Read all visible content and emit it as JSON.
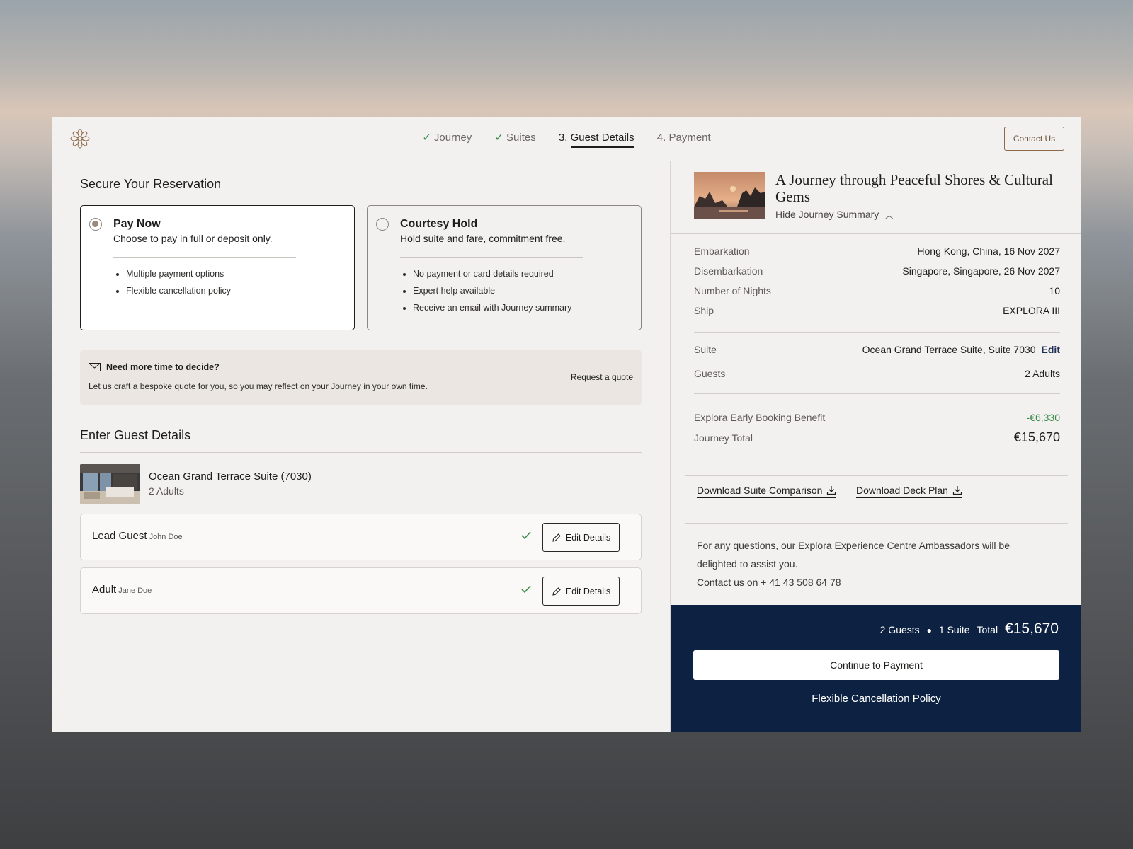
{
  "header": {
    "steps": [
      {
        "label": "Journey",
        "prefix": "",
        "done": true
      },
      {
        "label": "Suites",
        "prefix": "",
        "done": true
      },
      {
        "label": "Guest Details",
        "prefix": "3.",
        "done": false,
        "active": true
      },
      {
        "label": "Payment",
        "prefix": "4.",
        "done": false
      }
    ],
    "contact_label": "Contact Us"
  },
  "reservation": {
    "title": "Secure Your Reservation",
    "options": [
      {
        "title": "Pay Now",
        "subtitle": "Choose to pay in full or deposit only.",
        "bullets": [
          "Multiple payment options",
          "Flexible cancellation policy"
        ],
        "selected": true
      },
      {
        "title": "Courtesy Hold",
        "subtitle": "Hold suite and fare, commitment free.",
        "bullets": [
          "No payment or card details required",
          "Expert help available",
          "Receive an email with Journey summary"
        ],
        "selected": false
      }
    ]
  },
  "quote": {
    "title": "Need more time to decide?",
    "text": "Let us craft a bespoke quote for you, so you may reflect on your Journey in your own time.",
    "link": "Request a quote"
  },
  "guests": {
    "title": "Enter Guest Details",
    "suite_name": "Ocean Grand Terrace Suite (7030)",
    "suite_guests": "2 Adults",
    "edit_label": "Edit Details",
    "list": [
      {
        "role": "Lead Guest",
        "name": "John Doe"
      },
      {
        "role": "Adult",
        "name": "Jane Doe"
      }
    ]
  },
  "summary": {
    "journey_title": "A Journey through Peaceful Shores & Cultural Gems",
    "hide_label": "Hide Journey Summary",
    "rows": [
      {
        "k": "Embarkation",
        "v": "Hong Kong, China, 16 Nov 2027"
      },
      {
        "k": "Disembarkation",
        "v": "Singapore, Singapore, 26 Nov 2027"
      },
      {
        "k": "Number of Nights",
        "v": "10"
      },
      {
        "k": "Ship",
        "v": "EXPLORA III"
      }
    ],
    "suite_label": "Suite",
    "suite_value": "Ocean Grand Terrace Suite, Suite 7030",
    "edit_link": "Edit",
    "guests_label": "Guests",
    "guests_value": "2 Adults",
    "benefit_label": "Explora Early Booking Benefit",
    "benefit_value": "-€6,330",
    "total_label": "Journey Total",
    "total_value": "€15,670",
    "download_comparison": "Download Suite Comparison",
    "download_deck": "Download Deck Plan",
    "help_text": "For any questions, our Explora Experience Centre Ambassadors will be delighted to assist you.",
    "contact_prefix": "Contact us on",
    "phone": "+ 41 43 508 64 78"
  },
  "footer": {
    "guests": "2 Guests",
    "suites": "1 Suite",
    "total_label": "Total",
    "total_value": "€15,670",
    "cta": "Continue to Payment",
    "policy": "Flexible Cancellation Policy"
  },
  "colors": {
    "accent_dark": "#0d2142",
    "success": "#3a8a4a",
    "brand_bronze": "#8c6a4a"
  },
  "icons": [
    "logo-flower-icon",
    "check-icon",
    "mail-icon",
    "pencil-icon",
    "chevron-up-icon",
    "download-icon"
  ]
}
